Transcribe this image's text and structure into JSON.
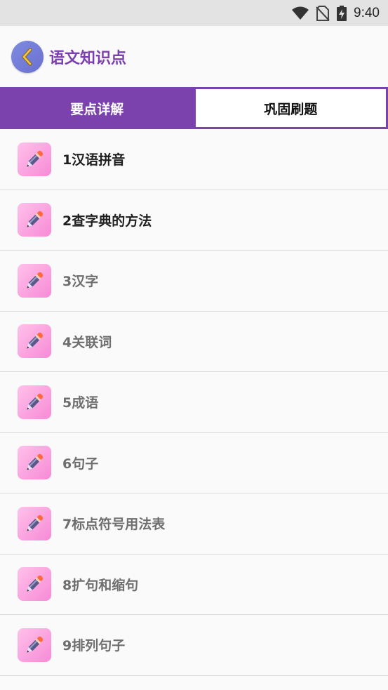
{
  "status_bar": {
    "time": "9:40"
  },
  "header": {
    "title": "语文知识点"
  },
  "tabs": [
    {
      "label": "要点详解",
      "active": true
    },
    {
      "label": "巩固刷题",
      "active": false
    }
  ],
  "items": [
    {
      "label": "1汉语拼音"
    },
    {
      "label": "2查字典的方法"
    },
    {
      "label": "3汉字"
    },
    {
      "label": "4关联词"
    },
    {
      "label": "5成语"
    },
    {
      "label": "6句子"
    },
    {
      "label": "7标点符号用法表"
    },
    {
      "label": "8扩句和缩句"
    },
    {
      "label": "9排列句子"
    }
  ],
  "colors": {
    "accent": "#7b41ad",
    "title": "#7b3fb0",
    "icon_bg": "#f78ad6"
  }
}
